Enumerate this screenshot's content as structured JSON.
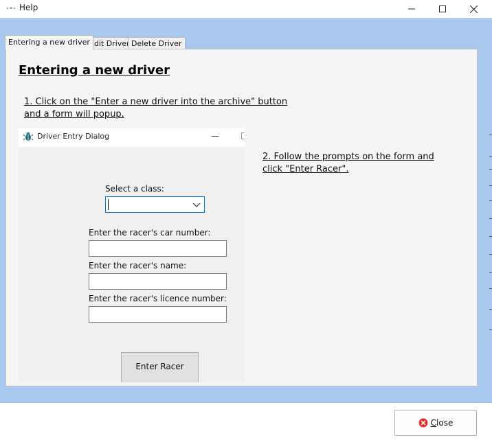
{
  "window": {
    "title": "Help",
    "minimize_glyph": "—",
    "maximize_glyph": "☐",
    "close_glyph": "✕"
  },
  "tabs": [
    {
      "label": "Entering a new driver",
      "active": true
    },
    {
      "label": "Edit Driver",
      "active": false
    },
    {
      "label": "Delete Driver",
      "active": false
    }
  ],
  "content": {
    "heading": "Entering a new driver",
    "step1": "1. Click on the \"Enter a new driver into the archive\" button and a form will popup.",
    "step2": "2. Follow the prompts on the form and click \"Enter Racer\"."
  },
  "dialog": {
    "title": "Driver Entry Dialog",
    "minimize_glyph": "—",
    "select_class_label": "Select a class:",
    "select_class_value": "",
    "car_number_label": "Enter the racer's car number:",
    "car_number_value": "",
    "name_label": "Enter the racer's name:",
    "name_value": "",
    "licence_label": "Enter the racer's licence number:",
    "licence_value": "",
    "enter_button": "Enter Racer"
  },
  "footer": {
    "close_mnemonic": "C",
    "close_rest": "lose"
  },
  "colors": {
    "window_blue": "#a8c8ee",
    "panel": "#f5f5f5",
    "dialog_bg": "#f0f0f0",
    "focus_border": "#0078d7",
    "close_icon_red": "#d9342b"
  },
  "icons": {
    "app": "dots-icon",
    "dialog": "bug-icon",
    "dropdown": "chevron-down-icon",
    "close_button": "red-x-circle-icon"
  }
}
